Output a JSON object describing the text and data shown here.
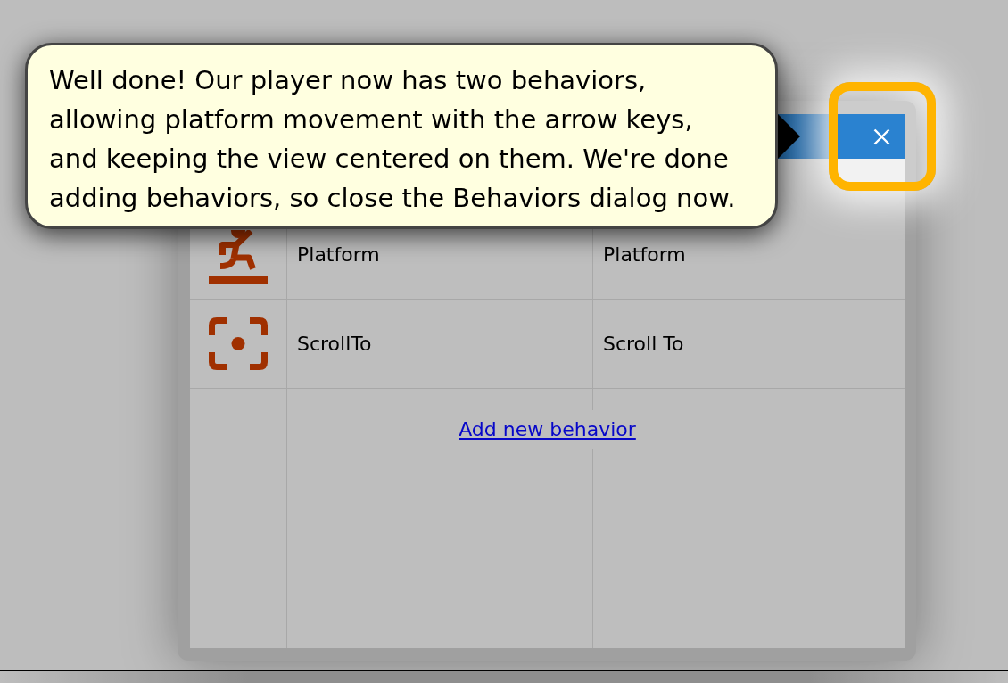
{
  "tutorial_tip": {
    "text": "Well done! Our player now has two behaviors, allowing platform movement with the arrow keys, and keeping the view centered on them. We're done adding behaviors, so close the Behaviors dialog now."
  },
  "behaviors_dialog": {
    "close_button": {
      "highlighted": true
    },
    "behaviors": [
      {
        "kind": "platform",
        "name": "Platform",
        "type": "Platform"
      },
      {
        "kind": "scroll_to",
        "name": "ScrollTo",
        "type": "Scroll To"
      }
    ],
    "add_behavior_link": "Add new behavior"
  }
}
